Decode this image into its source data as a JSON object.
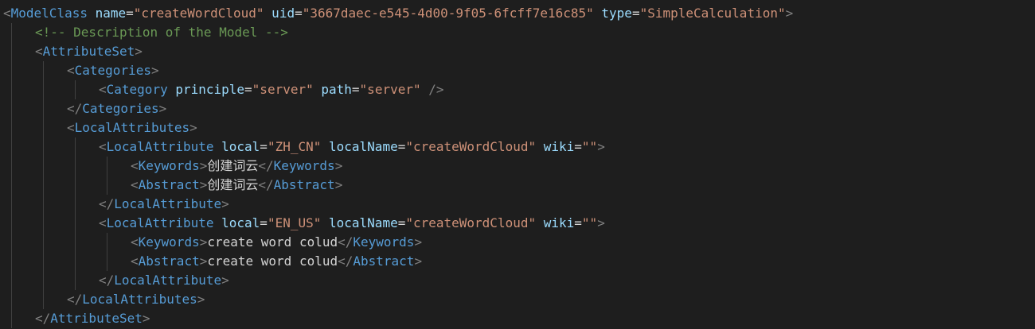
{
  "editor": {
    "language": "xml",
    "theme": "dark",
    "colors": {
      "background": "#1e1e1e",
      "bracket": "#808080",
      "tag": "#569cd6",
      "attribute": "#9cdcfe",
      "string": "#ce9178",
      "comment": "#6a9955",
      "text": "#d4d4d4",
      "indent_guide": "#404040"
    },
    "lines": [
      {
        "indent": 0,
        "tokens": [
          {
            "type": "b",
            "text": "<"
          },
          {
            "type": "t",
            "text": "ModelClass"
          },
          {
            "type": "a",
            "text": " name"
          },
          {
            "type": "x",
            "text": "="
          },
          {
            "type": "s",
            "text": "\"createWordCloud\""
          },
          {
            "type": "a",
            "text": " uid"
          },
          {
            "type": "x",
            "text": "="
          },
          {
            "type": "s",
            "text": "\"3667daec-e545-4d00-9f05-6fcff7e16c85\""
          },
          {
            "type": "a",
            "text": " type"
          },
          {
            "type": "x",
            "text": "="
          },
          {
            "type": "s",
            "text": "\"SimpleCalculation\""
          },
          {
            "type": "b",
            "text": ">"
          }
        ]
      },
      {
        "indent": 1,
        "tokens": [
          {
            "type": "c",
            "text": "<!-- Description of the Model -->"
          }
        ]
      },
      {
        "indent": 1,
        "tokens": [
          {
            "type": "b",
            "text": "<"
          },
          {
            "type": "t",
            "text": "AttributeSet"
          },
          {
            "type": "b",
            "text": ">"
          }
        ]
      },
      {
        "indent": 2,
        "tokens": [
          {
            "type": "b",
            "text": "<"
          },
          {
            "type": "t",
            "text": "Categories"
          },
          {
            "type": "b",
            "text": ">"
          }
        ]
      },
      {
        "indent": 3,
        "tokens": [
          {
            "type": "b",
            "text": "<"
          },
          {
            "type": "t",
            "text": "Category"
          },
          {
            "type": "a",
            "text": " principle"
          },
          {
            "type": "x",
            "text": "="
          },
          {
            "type": "s",
            "text": "\"server\""
          },
          {
            "type": "a",
            "text": " path"
          },
          {
            "type": "x",
            "text": "="
          },
          {
            "type": "s",
            "text": "\"server\""
          },
          {
            "type": "b",
            "text": " />"
          }
        ]
      },
      {
        "indent": 2,
        "tokens": [
          {
            "type": "b",
            "text": "</"
          },
          {
            "type": "t",
            "text": "Categories"
          },
          {
            "type": "b",
            "text": ">"
          }
        ]
      },
      {
        "indent": 2,
        "tokens": [
          {
            "type": "b",
            "text": "<"
          },
          {
            "type": "t",
            "text": "LocalAttributes"
          },
          {
            "type": "b",
            "text": ">"
          }
        ]
      },
      {
        "indent": 3,
        "tokens": [
          {
            "type": "b",
            "text": "<"
          },
          {
            "type": "t",
            "text": "LocalAttribute"
          },
          {
            "type": "a",
            "text": " local"
          },
          {
            "type": "x",
            "text": "="
          },
          {
            "type": "s",
            "text": "\"ZH_CN\""
          },
          {
            "type": "a",
            "text": " localName"
          },
          {
            "type": "x",
            "text": "="
          },
          {
            "type": "s",
            "text": "\"createWordCloud\""
          },
          {
            "type": "a",
            "text": " wiki"
          },
          {
            "type": "x",
            "text": "="
          },
          {
            "type": "s",
            "text": "\"\""
          },
          {
            "type": "b",
            "text": ">"
          }
        ]
      },
      {
        "indent": 4,
        "tokens": [
          {
            "type": "b",
            "text": "<"
          },
          {
            "type": "t",
            "text": "Keywords"
          },
          {
            "type": "b",
            "text": ">"
          },
          {
            "type": "x",
            "text": "创建词云"
          },
          {
            "type": "b",
            "text": "</"
          },
          {
            "type": "t",
            "text": "Keywords"
          },
          {
            "type": "b",
            "text": ">"
          }
        ]
      },
      {
        "indent": 4,
        "tokens": [
          {
            "type": "b",
            "text": "<"
          },
          {
            "type": "t",
            "text": "Abstract"
          },
          {
            "type": "b",
            "text": ">"
          },
          {
            "type": "x",
            "text": "创建词云"
          },
          {
            "type": "b",
            "text": "</"
          },
          {
            "type": "t",
            "text": "Abstract"
          },
          {
            "type": "b",
            "text": ">"
          }
        ]
      },
      {
        "indent": 3,
        "tokens": [
          {
            "type": "b",
            "text": "</"
          },
          {
            "type": "t",
            "text": "LocalAttribute"
          },
          {
            "type": "b",
            "text": ">"
          }
        ]
      },
      {
        "indent": 3,
        "tokens": [
          {
            "type": "b",
            "text": "<"
          },
          {
            "type": "t",
            "text": "LocalAttribute"
          },
          {
            "type": "a",
            "text": " local"
          },
          {
            "type": "x",
            "text": "="
          },
          {
            "type": "s",
            "text": "\"EN_US\""
          },
          {
            "type": "a",
            "text": " localName"
          },
          {
            "type": "x",
            "text": "="
          },
          {
            "type": "s",
            "text": "\"createWordCloud\""
          },
          {
            "type": "a",
            "text": " wiki"
          },
          {
            "type": "x",
            "text": "="
          },
          {
            "type": "s",
            "text": "\"\""
          },
          {
            "type": "b",
            "text": ">"
          }
        ]
      },
      {
        "indent": 4,
        "tokens": [
          {
            "type": "b",
            "text": "<"
          },
          {
            "type": "t",
            "text": "Keywords"
          },
          {
            "type": "b",
            "text": ">"
          },
          {
            "type": "x",
            "text": "create word colud"
          },
          {
            "type": "b",
            "text": "</"
          },
          {
            "type": "t",
            "text": "Keywords"
          },
          {
            "type": "b",
            "text": ">"
          }
        ]
      },
      {
        "indent": 4,
        "tokens": [
          {
            "type": "b",
            "text": "<"
          },
          {
            "type": "t",
            "text": "Abstract"
          },
          {
            "type": "b",
            "text": ">"
          },
          {
            "type": "x",
            "text": "create word colud"
          },
          {
            "type": "b",
            "text": "</"
          },
          {
            "type": "t",
            "text": "Abstract"
          },
          {
            "type": "b",
            "text": ">"
          }
        ]
      },
      {
        "indent": 3,
        "tokens": [
          {
            "type": "b",
            "text": "</"
          },
          {
            "type": "t",
            "text": "LocalAttribute"
          },
          {
            "type": "b",
            "text": ">"
          }
        ]
      },
      {
        "indent": 2,
        "tokens": [
          {
            "type": "b",
            "text": "</"
          },
          {
            "type": "t",
            "text": "LocalAttributes"
          },
          {
            "type": "b",
            "text": ">"
          }
        ]
      },
      {
        "indent": 1,
        "tokens": [
          {
            "type": "b",
            "text": "</"
          },
          {
            "type": "t",
            "text": "AttributeSet"
          },
          {
            "type": "b",
            "text": ">"
          }
        ]
      }
    ]
  }
}
